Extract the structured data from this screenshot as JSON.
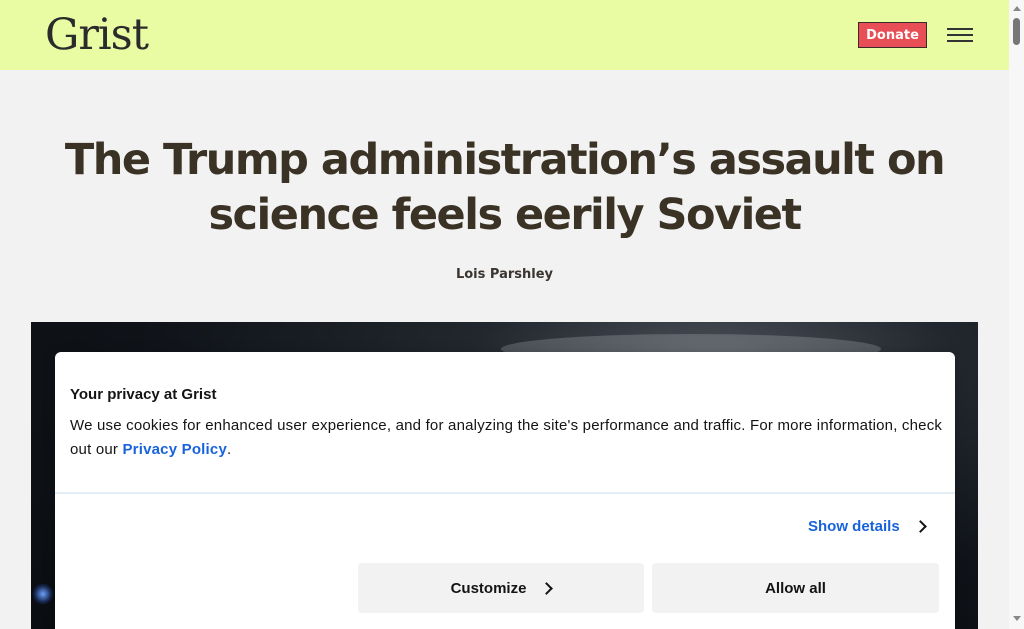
{
  "header": {
    "logo": "Grist",
    "donate_label": "Donate",
    "menu_icon": "hamburger-menu-icon",
    "background": "#e9fba3",
    "donate_color": "#e84e56"
  },
  "article": {
    "headline": "The Trump administration’s assault on science feels eerily Soviet",
    "byline": "Lois Parshley"
  },
  "consent": {
    "title": "Your privacy at Grist",
    "body_prefix": "We use cookies for enhanced user experience, and for analyzing the site's performance and traffic. For more information, check out our ",
    "privacy_link": "Privacy Policy",
    "body_suffix": ".",
    "show_details_label": "Show details",
    "customize_label": "Customize",
    "allow_all_label": "Allow all",
    "link_color": "#1863dc"
  }
}
